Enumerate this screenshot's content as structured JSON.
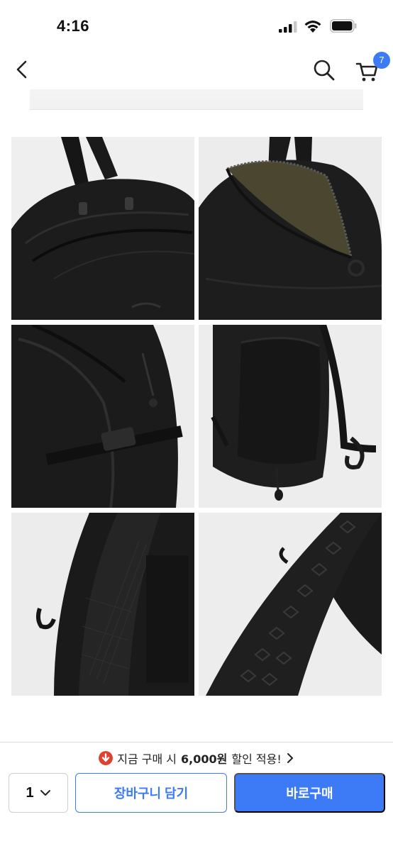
{
  "status_bar": {
    "time": "4:16"
  },
  "nav": {
    "cart_count": "7"
  },
  "gallery": {
    "photos": [
      "backpack-front-zipper-detail",
      "backpack-open-front-pocket",
      "backpack-side-buckle-strap",
      "backpack-side-mesh-pocket",
      "backpack-shoulder-strap-mesh",
      "backpack-strap-honeycomb-padding"
    ]
  },
  "bottom_bar": {
    "promo_prefix": "지금 구매 시",
    "promo_amount": "6,000원",
    "promo_suffix": "할인 적용!",
    "quantity": "1",
    "add_to_cart_label": "장바구니 담기",
    "buy_now_label": "바로구매"
  },
  "colors": {
    "accent": "#3c7bf5",
    "promo_icon": "#e0412f"
  }
}
